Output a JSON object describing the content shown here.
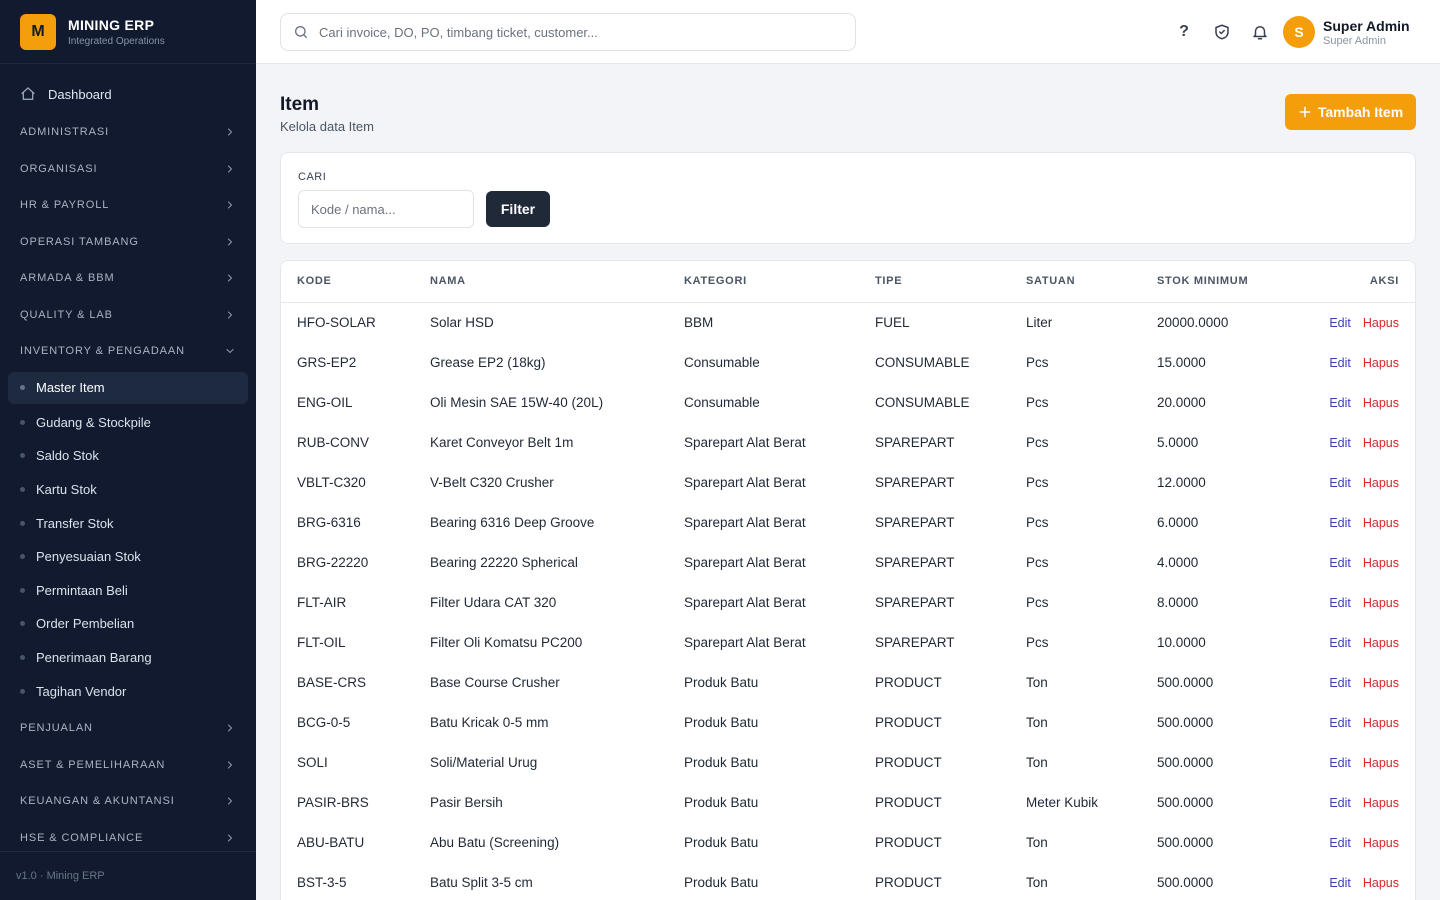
{
  "brand": {
    "logo_letter": "M",
    "title": "MINING ERP",
    "subtitle": "Integrated Operations"
  },
  "sidebar": {
    "dashboard": "Dashboard",
    "groups_before": [
      "ADMINISTRASI",
      "ORGANISASI",
      "HR & PAYROLL",
      "OPERASI TAMBANG",
      "ARMADA & BBM",
      "QUALITY & LAB"
    ],
    "open_group": "INVENTORY & PENGADAAN",
    "sub_items": [
      "Master Item",
      "Gudang & Stockpile",
      "Saldo Stok",
      "Kartu Stok",
      "Transfer Stok",
      "Penyesuaian Stok",
      "Permintaan Beli",
      "Order Pembelian",
      "Penerimaan Barang",
      "Tagihan Vendor"
    ],
    "active_sub_item": "Master Item",
    "groups_after": [
      "PENJUALAN",
      "ASET & PEMELIHARAAN",
      "KEUANGAN & AKUNTANSI",
      "HSE & COMPLIANCE"
    ],
    "footer": "v1.0 · Mining ERP"
  },
  "header": {
    "search_placeholder": "Cari invoice, DO, PO, timbang ticket, customer...",
    "help_glyph": "?",
    "user": {
      "initial": "S",
      "name": "Super Admin",
      "role": "Super Admin"
    }
  },
  "page": {
    "title": "Item",
    "subtitle": "Kelola data Item",
    "add_button": "Tambah Item"
  },
  "filter": {
    "label": "CARI",
    "placeholder": "Kode / nama...",
    "button": "Filter"
  },
  "table": {
    "columns": [
      "KODE",
      "NAMA",
      "KATEGORI",
      "TIPE",
      "SATUAN",
      "STOK MINIMUM",
      "AKSI"
    ],
    "action_edit": "Edit",
    "action_delete": "Hapus",
    "rows": [
      [
        "HFO-SOLAR",
        "Solar HSD",
        "BBM",
        "FUEL",
        "Liter",
        "20000.0000"
      ],
      [
        "GRS-EP2",
        "Grease EP2 (18kg)",
        "Consumable",
        "CONSUMABLE",
        "Pcs",
        "15.0000"
      ],
      [
        "ENG-OIL",
        "Oli Mesin SAE 15W-40 (20L)",
        "Consumable",
        "CONSUMABLE",
        "Pcs",
        "20.0000"
      ],
      [
        "RUB-CONV",
        "Karet Conveyor Belt 1m",
        "Sparepart Alat Berat",
        "SPAREPART",
        "Pcs",
        "5.0000"
      ],
      [
        "VBLT-C320",
        "V-Belt C320 Crusher",
        "Sparepart Alat Berat",
        "SPAREPART",
        "Pcs",
        "12.0000"
      ],
      [
        "BRG-6316",
        "Bearing 6316 Deep Groove",
        "Sparepart Alat Berat",
        "SPAREPART",
        "Pcs",
        "6.0000"
      ],
      [
        "BRG-22220",
        "Bearing 22220 Spherical",
        "Sparepart Alat Berat",
        "SPAREPART",
        "Pcs",
        "4.0000"
      ],
      [
        "FLT-AIR",
        "Filter Udara CAT 320",
        "Sparepart Alat Berat",
        "SPAREPART",
        "Pcs",
        "8.0000"
      ],
      [
        "FLT-OIL",
        "Filter Oli Komatsu PC200",
        "Sparepart Alat Berat",
        "SPAREPART",
        "Pcs",
        "10.0000"
      ],
      [
        "BASE-CRS",
        "Base Course Crusher",
        "Produk Batu",
        "PRODUCT",
        "Ton",
        "500.0000"
      ],
      [
        "BCG-0-5",
        "Batu Kricak 0-5 mm",
        "Produk Batu",
        "PRODUCT",
        "Ton",
        "500.0000"
      ],
      [
        "SOLI",
        "Soli/Material Urug",
        "Produk Batu",
        "PRODUCT",
        "Ton",
        "500.0000"
      ],
      [
        "PASIR-BRS",
        "Pasir Bersih",
        "Produk Batu",
        "PRODUCT",
        "Meter Kubik",
        "500.0000"
      ],
      [
        "ABU-BATU",
        "Abu Batu (Screening)",
        "Produk Batu",
        "PRODUCT",
        "Ton",
        "500.0000"
      ],
      [
        "BST-3-5",
        "Batu Split 3-5 cm",
        "Produk Batu",
        "PRODUCT",
        "Ton",
        "500.0000"
      ]
    ]
  },
  "colors": {
    "sidebar_bg": "#111a2e",
    "accent": "#f59e0b",
    "link": "#3b3fbf",
    "danger": "#dc2626",
    "dark_button": "#1f2937"
  }
}
